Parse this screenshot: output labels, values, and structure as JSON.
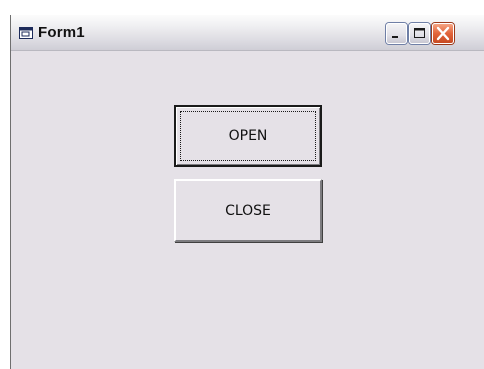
{
  "window": {
    "title": "Form1",
    "icon": "form-window-icon",
    "controls": {
      "minimize_icon": "minimize-icon",
      "maximize_icon": "maximize-icon",
      "close_icon": "close-icon"
    }
  },
  "form": {
    "open_button_label": "OPEN",
    "close_button_label": "CLOSE",
    "focused_button": "OPEN"
  },
  "colors": {
    "client_background": "#e5e1e7",
    "close_control": "#e2643b"
  }
}
